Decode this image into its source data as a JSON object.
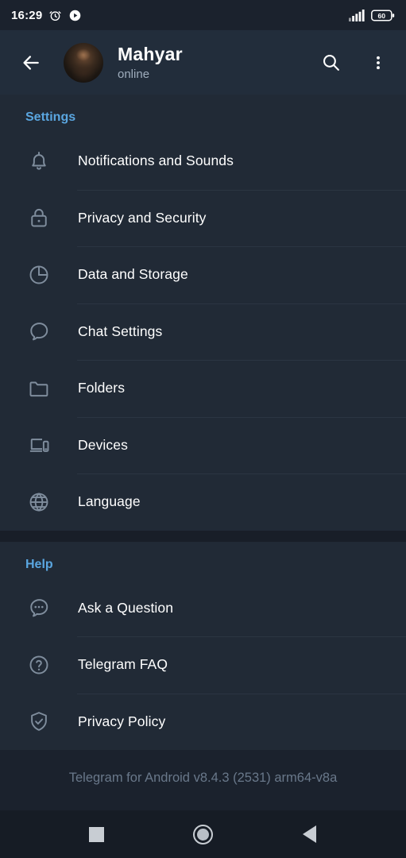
{
  "status_bar": {
    "time": "16:29",
    "icons_left": [
      "alarm-icon",
      "play-circle-icon"
    ],
    "icons_right": [
      "signal-bars-icon",
      "battery-icon"
    ],
    "battery_level": "60"
  },
  "header": {
    "back_icon": "back-arrow-icon",
    "avatar": "user-avatar",
    "name": "Mahyar",
    "status": "online",
    "search_icon": "search-icon",
    "menu_icon": "overflow-menu-icon"
  },
  "sections": [
    {
      "title": "Settings",
      "items": [
        {
          "label": "Notifications and Sounds",
          "icon": "bell-icon"
        },
        {
          "label": "Privacy and Security",
          "icon": "lock-icon"
        },
        {
          "label": "Data and Storage",
          "icon": "pie-chart-icon"
        },
        {
          "label": "Chat Settings",
          "icon": "chat-bubble-icon"
        },
        {
          "label": "Folders",
          "icon": "folder-icon"
        },
        {
          "label": "Devices",
          "icon": "devices-icon"
        },
        {
          "label": "Language",
          "icon": "globe-icon"
        }
      ]
    },
    {
      "title": "Help",
      "items": [
        {
          "label": "Ask a Question",
          "icon": "chat-ellipsis-icon"
        },
        {
          "label": "Telegram FAQ",
          "icon": "question-circle-icon"
        },
        {
          "label": "Privacy Policy",
          "icon": "shield-check-icon"
        }
      ]
    }
  ],
  "footer": {
    "version_text": "Telegram for Android v8.4.3 (2531) arm64-v8a"
  },
  "navbar": {
    "recents_icon": "square-icon",
    "home_icon": "circle-icon",
    "back_icon": "triangle-back-icon"
  },
  "colors": {
    "accent": "#5aa6e0",
    "list_bg": "#212a36",
    "page_bg": "#1b222d",
    "icon": "#7f8d9d",
    "divider": "#2b3542",
    "footer_text": "#69788a"
  }
}
